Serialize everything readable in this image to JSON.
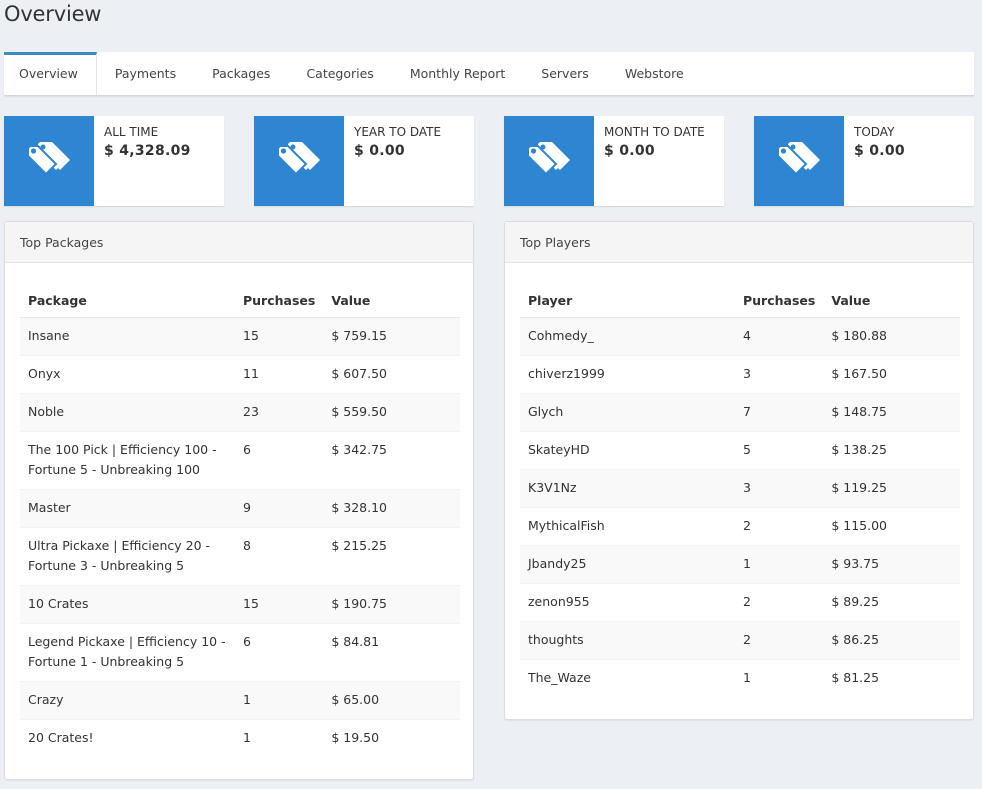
{
  "page": {
    "title": "Overview"
  },
  "tabs": [
    {
      "label": "Overview",
      "active": true
    },
    {
      "label": "Payments"
    },
    {
      "label": "Packages"
    },
    {
      "label": "Categories"
    },
    {
      "label": "Monthly Report"
    },
    {
      "label": "Servers"
    },
    {
      "label": "Webstore"
    }
  ],
  "stats": [
    {
      "label": "ALL TIME",
      "value": "$ 4,328.09",
      "icon": "tags-icon"
    },
    {
      "label": "YEAR TO DATE",
      "value": "$ 0.00",
      "icon": "tags-icon"
    },
    {
      "label": "MONTH TO DATE",
      "value": "$ 0.00",
      "icon": "tags-icon"
    },
    {
      "label": "TODAY",
      "value": "$ 0.00",
      "icon": "tags-icon"
    }
  ],
  "colors": {
    "accent": "#2e85d2",
    "tab_active": "#3c8dbc",
    "background": "#ecf0f5"
  },
  "top_packages": {
    "title": "Top Packages",
    "columns": [
      "Package",
      "Purchases",
      "Value"
    ],
    "rows": [
      {
        "name": "Insane",
        "purchases": "15",
        "value": "$ 759.15"
      },
      {
        "name": "Onyx",
        "purchases": "11",
        "value": "$ 607.50"
      },
      {
        "name": "Noble",
        "purchases": "23",
        "value": "$ 559.50"
      },
      {
        "name": "The 100 Pick | Efficiency 100 - Fortune 5 - Unbreaking 100",
        "purchases": "6",
        "value": "$ 342.75"
      },
      {
        "name": "Master",
        "purchases": "9",
        "value": "$ 328.10"
      },
      {
        "name": "Ultra Pickaxe | Efficiency 20 - Fortune 3 - Unbreaking 5",
        "purchases": "8",
        "value": "$ 215.25"
      },
      {
        "name": "10 Crates",
        "purchases": "15",
        "value": "$ 190.75"
      },
      {
        "name": "Legend Pickaxe | Efficiency 10 - Fortune 1 - Unbreaking 5",
        "purchases": "6",
        "value": "$ 84.81"
      },
      {
        "name": "Crazy",
        "purchases": "1",
        "value": "$ 65.00"
      },
      {
        "name": "20 Crates!",
        "purchases": "1",
        "value": "$ 19.50"
      }
    ]
  },
  "top_players": {
    "title": "Top Players",
    "columns": [
      "Player",
      "Purchases",
      "Value"
    ],
    "rows": [
      {
        "name": "Cohmedy_",
        "purchases": "4",
        "value": "$ 180.88"
      },
      {
        "name": "chiverz1999",
        "purchases": "3",
        "value": "$ 167.50"
      },
      {
        "name": "Glych",
        "purchases": "7",
        "value": "$ 148.75"
      },
      {
        "name": "SkateyHD",
        "purchases": "5",
        "value": "$ 138.25"
      },
      {
        "name": "K3V1Nz",
        "purchases": "3",
        "value": "$ 119.25"
      },
      {
        "name": "MythicalFish",
        "purchases": "2",
        "value": "$ 115.00"
      },
      {
        "name": "Jbandy25",
        "purchases": "1",
        "value": "$ 93.75"
      },
      {
        "name": "zenon955",
        "purchases": "2",
        "value": "$ 89.25"
      },
      {
        "name": "thoughts",
        "purchases": "2",
        "value": "$ 86.25"
      },
      {
        "name": "The_Waze",
        "purchases": "1",
        "value": "$ 81.25"
      }
    ]
  }
}
